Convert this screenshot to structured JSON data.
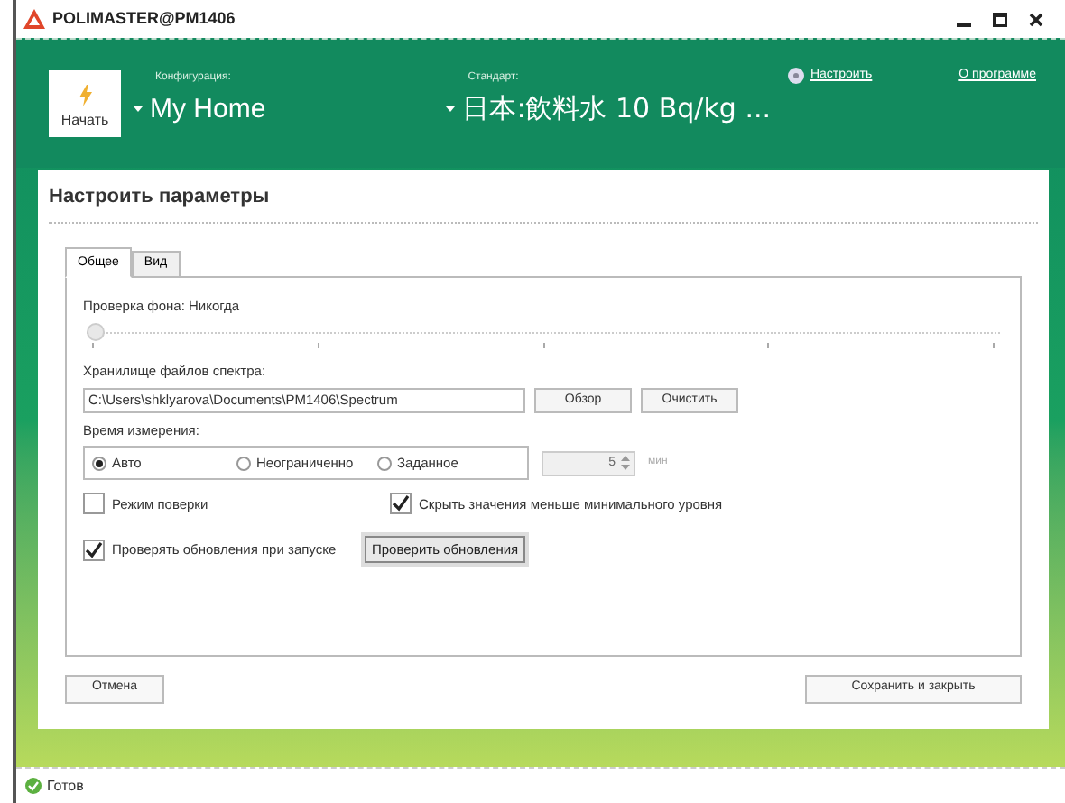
{
  "window": {
    "title": "POLIMASTER@PM1406"
  },
  "header": {
    "start_button": "Начать",
    "configuration": {
      "label": "Конфигурация:",
      "value": "My Home"
    },
    "standard": {
      "label": "Стандарт:",
      "value": "日本:飲料水 10 Bq/kg ..."
    },
    "links": [
      "Настроить",
      "О программе"
    ]
  },
  "dialog": {
    "title": "Настроить параметры",
    "tabs": [
      {
        "label": "Общее",
        "selected": true
      },
      {
        "label": "Вид",
        "selected": false
      }
    ],
    "background_check": {
      "label": "Проверка фона: Никогда",
      "level": 0
    },
    "spectrum_storage": {
      "label": "Хранилище файлов спектра:",
      "value": "C:\\Users\\shklyarova\\Documents\\PM1406\\Spectrum",
      "buttons": [
        "Обзор",
        "Очистить"
      ]
    },
    "measurement_time": {
      "label": "Время измерения:",
      "options": [
        {
          "label": "Авто",
          "selected": true
        },
        {
          "label": "Неограниченно",
          "selected": false
        },
        {
          "label": "Заданное",
          "selected": false
        }
      ],
      "value": "5",
      "unit": "мин"
    },
    "checkboxes": [
      {
        "label": "Режим поверки",
        "checked": false
      },
      {
        "label": "Скрыть значения меньше минимального уровня",
        "checked": true
      },
      {
        "label": "Проверять обновления при запуске",
        "checked": true
      }
    ],
    "check_updates_button": "Проверить обновления",
    "cancel_button": "Отмена",
    "save_button": "Сохранить и закрыть"
  },
  "status_bar": {
    "text": "Готов"
  }
}
